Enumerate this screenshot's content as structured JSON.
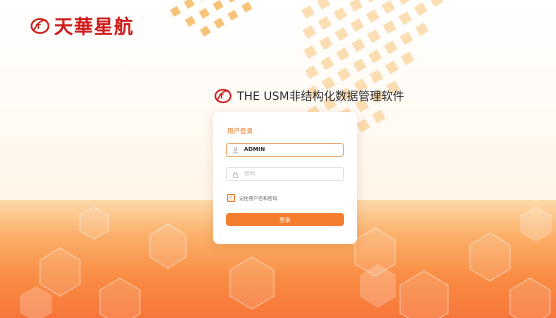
{
  "brand": {
    "name": "天華星航"
  },
  "title": {
    "text": "THE USM非结构化数据管理软件"
  },
  "login": {
    "heading": "用户登录",
    "username": {
      "value": "ADMIN",
      "placeholder": ""
    },
    "password": {
      "value": "",
      "placeholder": "密码"
    },
    "remember_label": "记住用户名和密码",
    "remember_checked": true,
    "submit_label": "登录"
  },
  "colors": {
    "accent": "#f57d2e",
    "brand_red": "#cc1c1c",
    "background_bottom": "#f7763a"
  },
  "icons": {
    "brand": "brand-logo-icon",
    "user": "user-icon",
    "password": "lock-icon",
    "remember": "check-icon"
  }
}
